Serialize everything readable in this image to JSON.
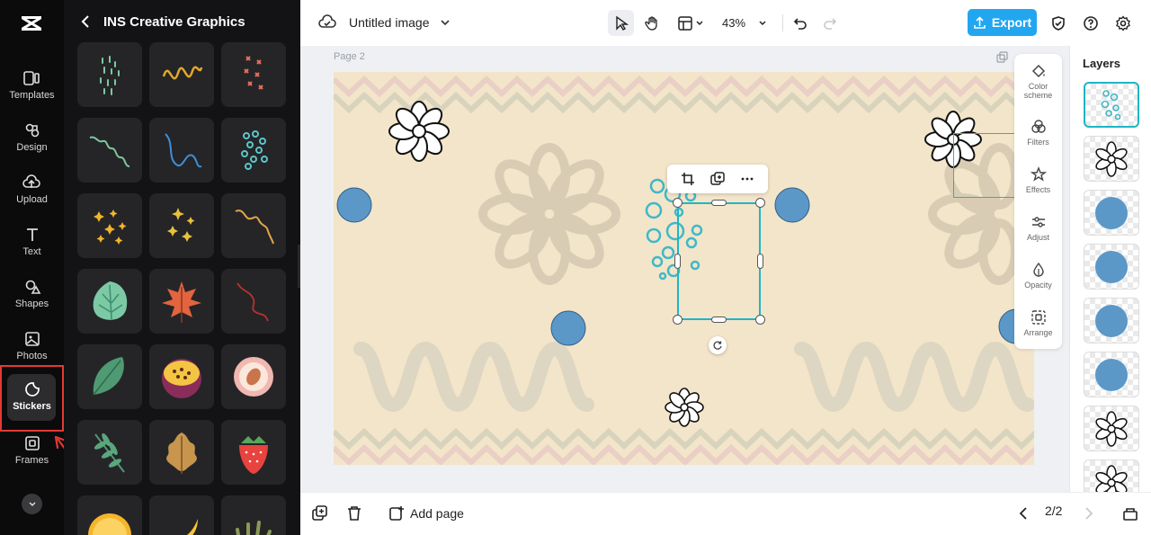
{
  "rail": {
    "items": [
      {
        "label": "Templates",
        "icon": "templates-icon"
      },
      {
        "label": "Design",
        "icon": "design-icon"
      },
      {
        "label": "Upload",
        "icon": "upload-icon"
      },
      {
        "label": "Text",
        "icon": "text-icon"
      },
      {
        "label": "Shapes",
        "icon": "shapes-icon"
      },
      {
        "label": "Photos",
        "icon": "photos-icon"
      },
      {
        "label": "Stickers",
        "icon": "stickers-icon",
        "active": true
      },
      {
        "label": "Frames",
        "icon": "frames-icon"
      }
    ]
  },
  "panel": {
    "title": "INS Creative Graphics"
  },
  "topbar": {
    "doc_title": "Untitled image",
    "zoom": "43%",
    "export_label": "Export"
  },
  "canvas": {
    "page_label": "Page 2"
  },
  "props": {
    "items": [
      {
        "label": "Color scheme",
        "icon": "color-scheme-icon"
      },
      {
        "label": "Filters",
        "icon": "filters-icon"
      },
      {
        "label": "Effects",
        "icon": "effects-icon"
      },
      {
        "label": "Adjust",
        "icon": "adjust-icon"
      },
      {
        "label": "Opacity",
        "icon": "opacity-icon"
      },
      {
        "label": "Arrange",
        "icon": "arrange-icon"
      }
    ]
  },
  "layers": {
    "title": "Layers"
  },
  "bottombar": {
    "add_page": "Add page",
    "pager": "2/2"
  },
  "colors": {
    "accent": "#23a6f0",
    "selection": "#1fb5c7",
    "canvas_bg": "#f3e5c9",
    "highlight_box": "#e53935"
  }
}
